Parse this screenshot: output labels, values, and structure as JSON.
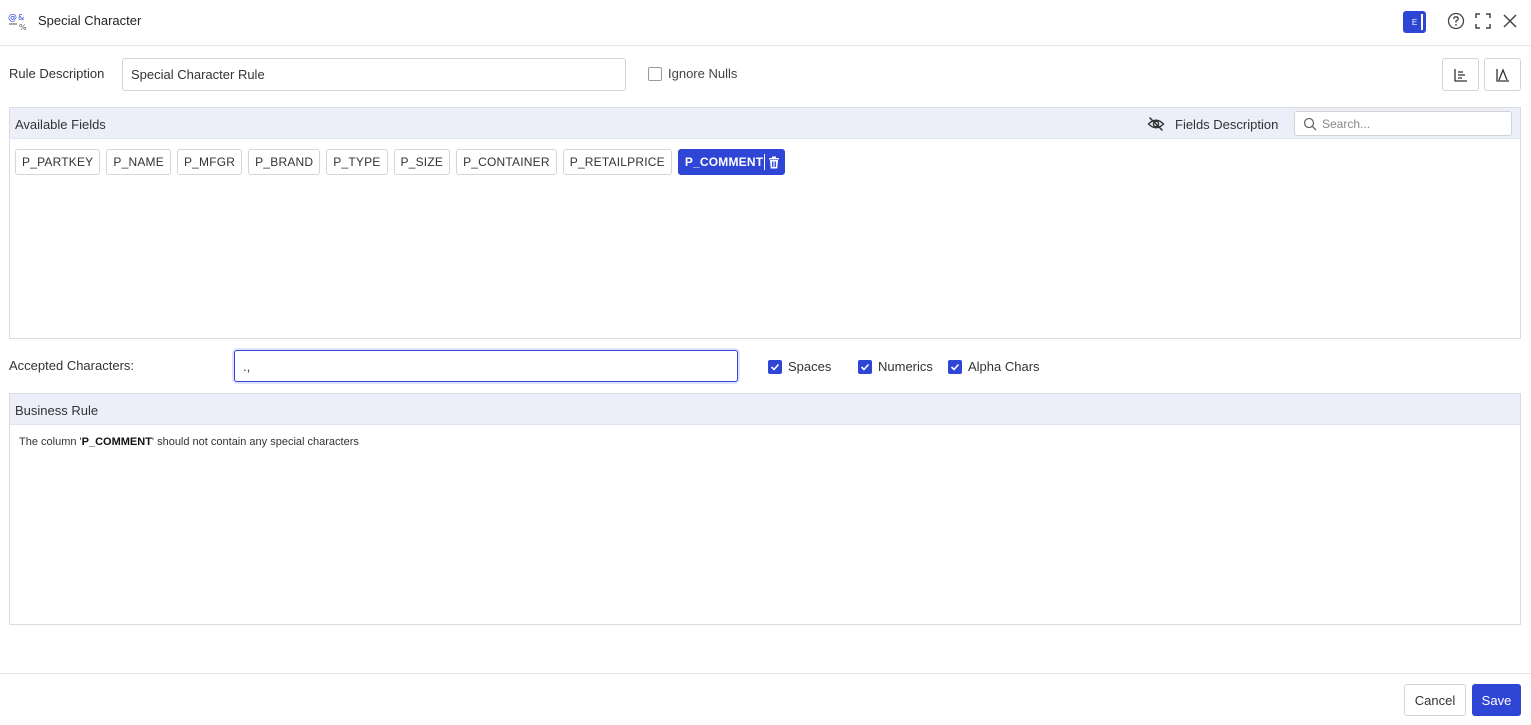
{
  "header": {
    "title": "Special Character",
    "env_badge": "E",
    "icons": [
      "special-character-icon",
      "help-icon",
      "fullscreen-icon",
      "close-icon"
    ]
  },
  "rule": {
    "label": "Rule Description",
    "value": "Special Character Rule",
    "ignore_nulls_label": "Ignore Nulls",
    "ignore_nulls_checked": false
  },
  "available_fields": {
    "title": "Available Fields",
    "fields_description_label": "Fields Description",
    "search_placeholder": "Search...",
    "fields": [
      "P_PARTKEY",
      "P_NAME",
      "P_MFGR",
      "P_BRAND",
      "P_TYPE",
      "P_SIZE",
      "P_CONTAINER",
      "P_RETAILPRICE",
      "P_COMMENT"
    ],
    "selected_field": "P_COMMENT"
  },
  "accepted": {
    "label": "Accepted Characters:",
    "value": ".,",
    "spaces_label": "Spaces",
    "numerics_label": "Numerics",
    "alpha_label": "Alpha Chars"
  },
  "business_rule": {
    "title": "Business Rule",
    "prefix": "The column '",
    "column": "P_COMMENT",
    "suffix": "' should not contain any special characters"
  },
  "footer": {
    "cancel_label": "Cancel",
    "save_label": "Save"
  },
  "colors": {
    "accent": "#2f45d6",
    "panel_header": "#eceffa"
  }
}
